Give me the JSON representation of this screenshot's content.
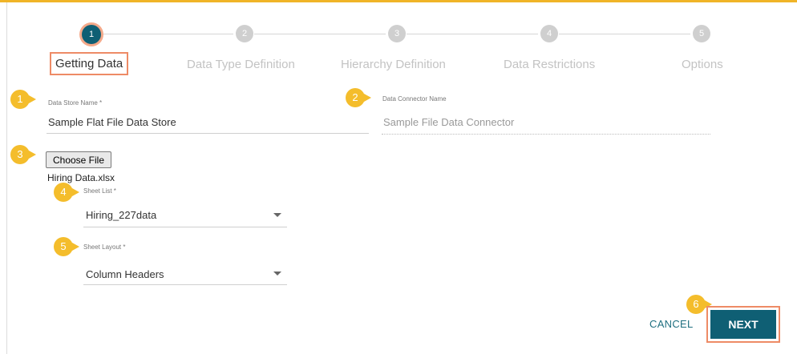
{
  "stepper": {
    "steps": [
      {
        "number": "1",
        "label": "Getting Data"
      },
      {
        "number": "2",
        "label": "Data Type Definition"
      },
      {
        "number": "3",
        "label": "Hierarchy Definition"
      },
      {
        "number": "4",
        "label": "Data Restrictions"
      },
      {
        "number": "5",
        "label": "Options"
      }
    ],
    "active_step": 1
  },
  "callouts": [
    "1",
    "2",
    "3",
    "4",
    "5",
    "6"
  ],
  "form": {
    "data_store_name": {
      "label": "Data Store Name *",
      "value": "Sample Flat File Data Store"
    },
    "data_connector_name": {
      "label": "Data Connector Name",
      "placeholder": "Sample File Data Connector"
    },
    "file": {
      "button_label": "Choose File",
      "file_name": "Hiring Data.xlsx"
    },
    "sheet_list": {
      "label": "Sheet List *",
      "value": "Hiring_227data"
    },
    "sheet_layout": {
      "label": "Sheet Layout *",
      "value": "Column Headers"
    }
  },
  "actions": {
    "cancel_label": "CANCEL",
    "next_label": "NEXT"
  },
  "colors": {
    "primary": "#0f5f74",
    "callout": "#f4bd2c",
    "highlight": "#ee8b66",
    "accent_border": "#f0b428"
  }
}
